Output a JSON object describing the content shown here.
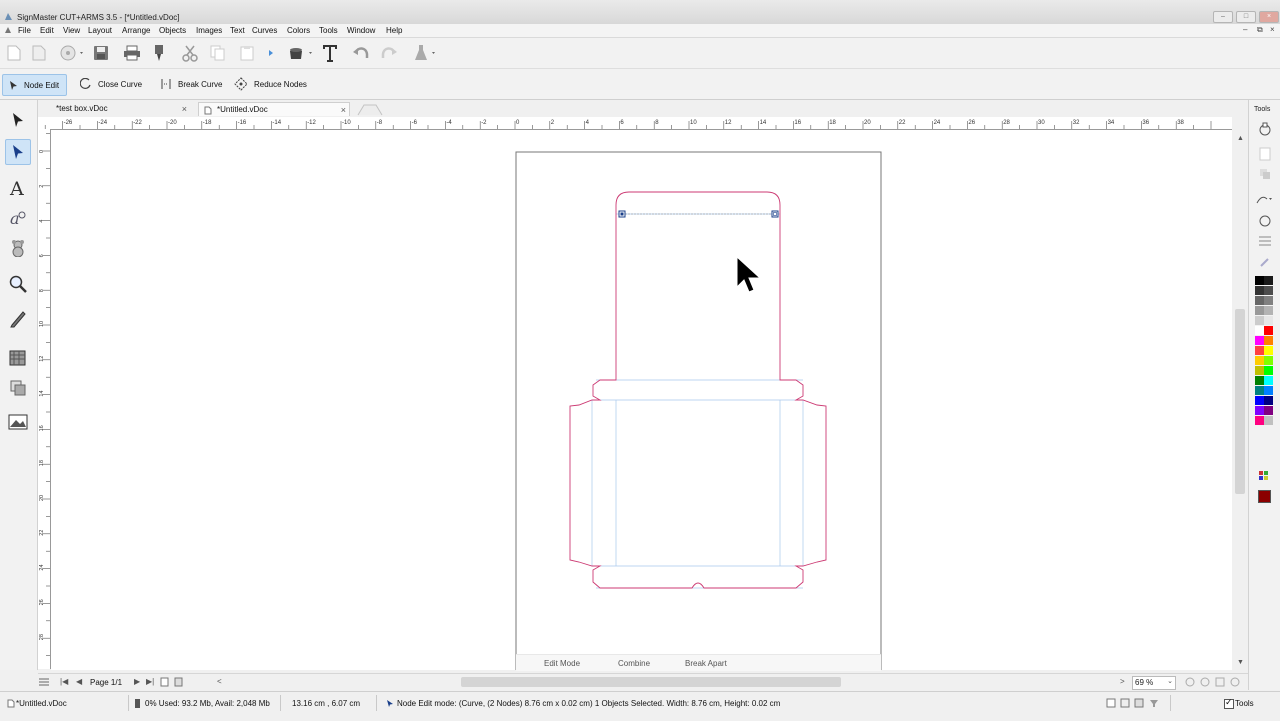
{
  "window": {
    "title": "SignMaster CUT+ARMS 3.5 - [*Untitled.vDoc]"
  },
  "menu": [
    "File",
    "Edit",
    "View",
    "Layout",
    "Arrange",
    "Objects",
    "Images",
    "Text",
    "Curves",
    "Colors",
    "Tools",
    "Window",
    "Help"
  ],
  "node_toolbar": {
    "node_edit": "Node Edit",
    "close_curve": "Close Curve",
    "break_curve": "Break Curve",
    "reduce_nodes": "Reduce Nodes"
  },
  "tabs": [
    {
      "label": "*test box.vDoc"
    },
    {
      "label": "*Untitled.vDoc"
    }
  ],
  "right_panel": {
    "title": "Tools"
  },
  "ruler": {
    "h_labels": [
      "-26",
      "-24",
      "-22",
      "-20",
      "-18",
      "-16",
      "-14",
      "-12",
      "-10",
      "-8",
      "-6",
      "-4",
      "-2",
      "0",
      "2",
      "4",
      "6",
      "8",
      "10",
      "12",
      "14",
      "16",
      "18",
      "20",
      "22",
      "24",
      "26",
      "28",
      "30",
      "32",
      "34",
      "36",
      "38"
    ],
    "v_labels": [
      "0",
      "2",
      "4",
      "6",
      "8",
      "10",
      "12",
      "14",
      "16",
      "18",
      "20",
      "22",
      "24",
      "26",
      "28"
    ],
    "unit": "cm"
  },
  "canvas_actions": {
    "edit_mode": "Edit Mode",
    "combine": "Combine",
    "break_apart": "Break Apart"
  },
  "page_nav": {
    "label": "Page 1/1"
  },
  "zoom": {
    "value": "69 %"
  },
  "status": {
    "doc": "*Untitled.vDoc",
    "memory": "0%   Used: 93.2 Mb, Avail: 2,048 Mb",
    "coords": "13.16 cm , 6.07 cm",
    "mode": "Node Edit mode: (Curve, (2 Nodes) 8.76 cm x 0.02 cm)  1 Objects Selected.  Width: 8.76 cm, Height: 0.02 cm",
    "tools": "Tools"
  },
  "palette": [
    "#000000",
    "#1a1a1a",
    "#333333",
    "#4d4d4d",
    "#666666",
    "#808080",
    "#999999",
    "#b3b3b3",
    "#cccccc",
    "#e6e6e6",
    "#ffffff",
    "#ff0000",
    "#ff00ff",
    "#ff8000",
    "#ff4040",
    "#ffff00",
    "#ffcc00",
    "#80ff00",
    "#c0c000",
    "#00ff00",
    "#008000",
    "#00ffff",
    "#008080",
    "#0080ff",
    "#0000ff",
    "#000080",
    "#8000ff",
    "#800080",
    "#ff0080",
    "#c0c0c0"
  ],
  "colors": {
    "accent": "#cfe4f7",
    "cutline": "#cc3a73",
    "guide": "#a8c8ec",
    "current_fill": "#8b0000"
  }
}
